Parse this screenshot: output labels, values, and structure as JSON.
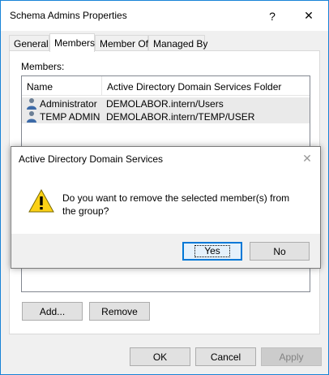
{
  "window": {
    "title": "Schema Admins Properties",
    "help_glyph": "?",
    "close_glyph": "✕"
  },
  "tabs": [
    {
      "label": "General"
    },
    {
      "label": "Members"
    },
    {
      "label": "Member Of"
    },
    {
      "label": "Managed By"
    }
  ],
  "active_tab": "Members",
  "members": {
    "label": "Members:",
    "columns": [
      "Name",
      "Active Directory Domain Services Folder"
    ],
    "rows": [
      {
        "name": "Administrator",
        "folder": "DEMOLABOR.intern/Users"
      },
      {
        "name": "TEMP ADMIN",
        "folder": "DEMOLABOR.intern/TEMP/USER"
      }
    ],
    "add_label": "Add...",
    "remove_label": "Remove"
  },
  "footer": {
    "ok_label": "OK",
    "cancel_label": "Cancel",
    "apply_label": "Apply"
  },
  "dialog": {
    "title": "Active Directory Domain Services",
    "close_glyph": "✕",
    "message": "Do you want to remove the selected member(s) from the group?",
    "yes_label": "Yes",
    "no_label": "No",
    "icon": "warning-icon"
  },
  "colors": {
    "accent": "#1883d7",
    "warning": "#fcd116",
    "default_button": "#0078d7"
  }
}
